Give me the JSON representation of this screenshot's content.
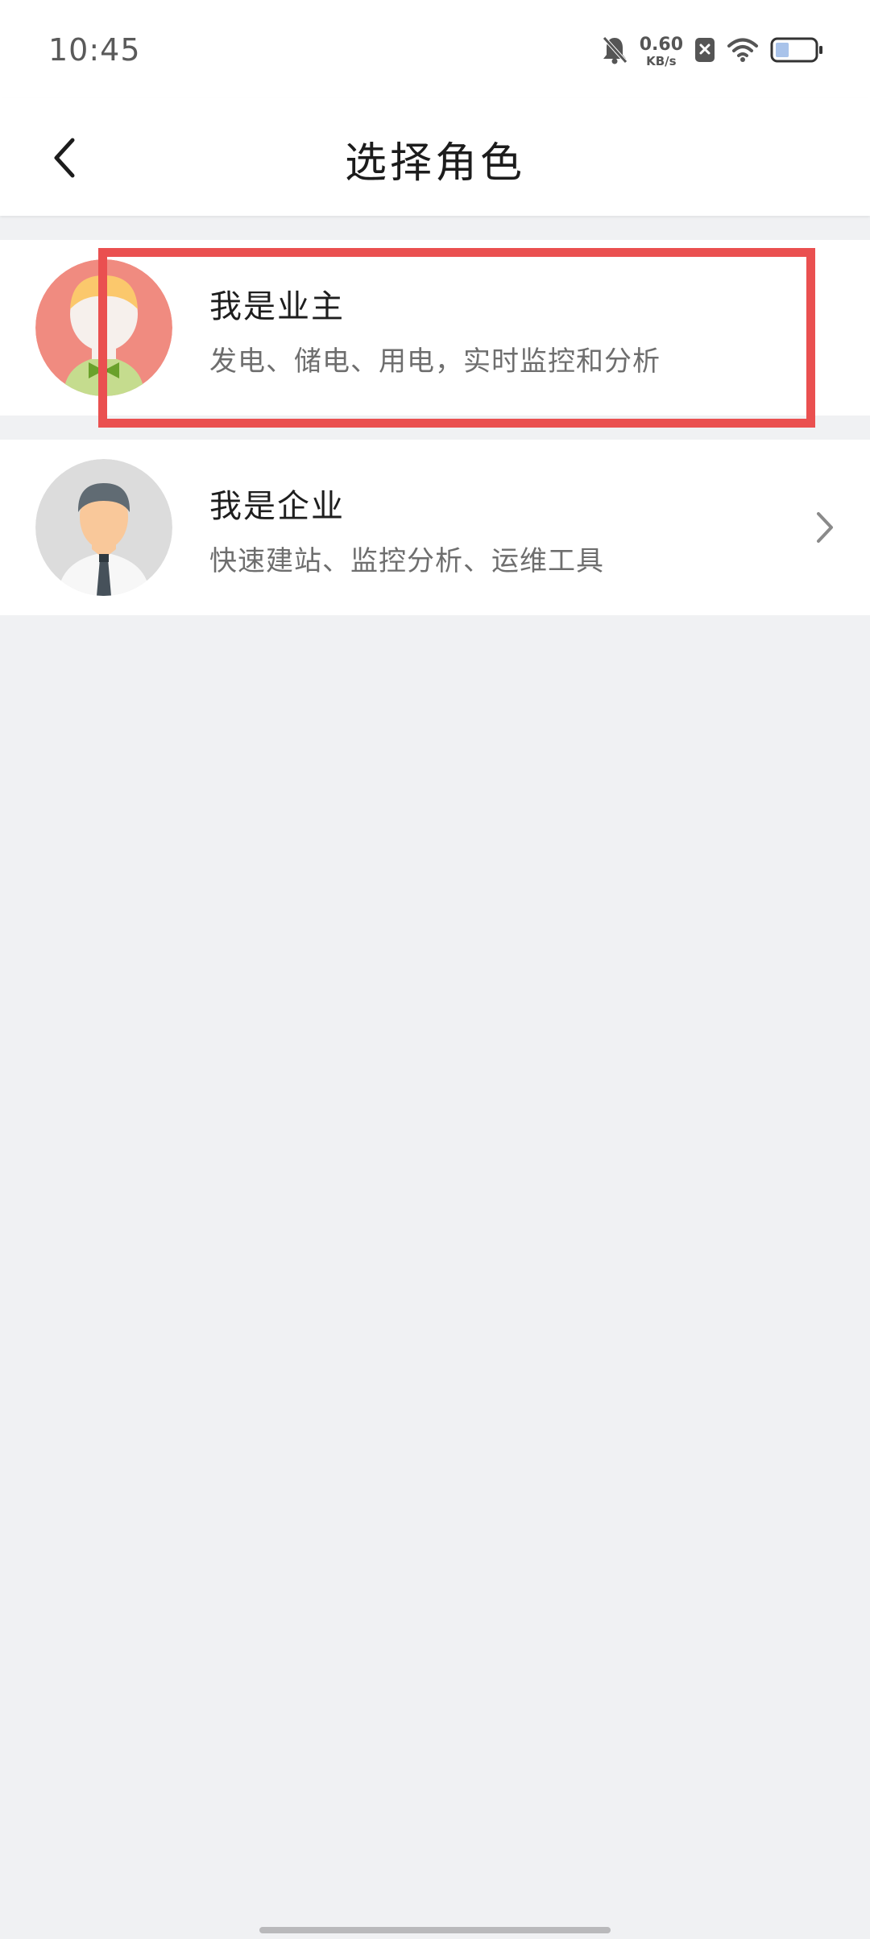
{
  "status_bar": {
    "time": "10:45",
    "net_speed_value": "0.60",
    "net_speed_unit": "KB/s",
    "icons": [
      "bell-muted-icon",
      "sim-blocked-icon",
      "wifi-icon",
      "battery-icon"
    ],
    "battery_level": 0.35
  },
  "header": {
    "title": "选择角色",
    "back_icon": "chevron-left-icon"
  },
  "roles": [
    {
      "title": "我是业主",
      "description": "发电、储电、用电，实时监控和分析",
      "avatar_icon": "owner-avatar-icon",
      "avatar_color": "#f08b80"
    },
    {
      "title": "我是企业",
      "description": "快速建站、监控分析、运维工具",
      "avatar_icon": "enterprise-avatar-icon",
      "avatar_color": "#dcdcdc"
    }
  ],
  "colors": {
    "background": "#f0f1f3",
    "highlight": "#ea5050",
    "title_text": "#1c1c1c",
    "secondary_text": "#6e6e6e"
  }
}
